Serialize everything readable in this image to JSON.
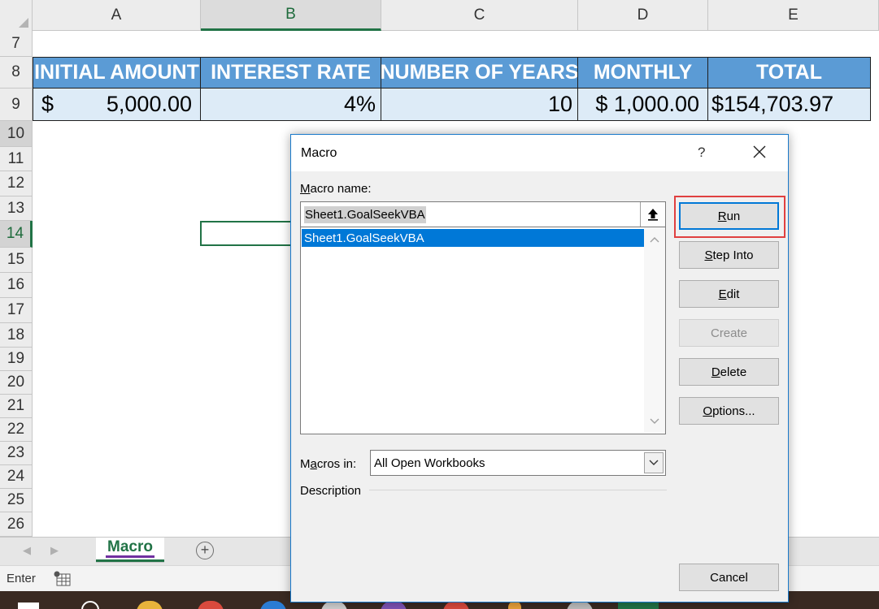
{
  "spreadsheet": {
    "columns": [
      "A",
      "B",
      "C",
      "D",
      "E"
    ],
    "rows": [
      "7",
      "8",
      "9",
      "10",
      "11",
      "12",
      "13",
      "14",
      "15",
      "16",
      "17",
      "18",
      "19",
      "20",
      "21",
      "22",
      "23",
      "24",
      "25",
      "26"
    ],
    "table_headers": [
      "INITIAL AMOUNT",
      "INTEREST RATE",
      "NUMBER OF YEARS",
      "MONTHLY",
      "TOTAL"
    ],
    "values": {
      "initial_currency": "$",
      "initial_amount": "5,000.00",
      "interest_rate": "4%",
      "years": "10",
      "monthly": "$ 1,000.00",
      "total": "$154,703.97"
    }
  },
  "sheet_tabs": {
    "active": "Macro"
  },
  "status_bar": {
    "mode": "Enter"
  },
  "dialog": {
    "title": "Macro",
    "help": "?",
    "macro_name_label_key": "M",
    "macro_name_label_rest": "acro name:",
    "macro_name_value": "Sheet1.GoalSeekVBA",
    "macro_list": [
      "Sheet1.GoalSeekVBA"
    ],
    "macros_in_label_pre": "M",
    "macros_in_label_key": "a",
    "macros_in_label_rest": "cros in:",
    "macros_in_value": "All Open Workbooks",
    "description_label": "Description",
    "buttons": {
      "run_key": "R",
      "run_rest": "un",
      "step_key": "S",
      "step_rest": "tep Into",
      "edit_key": "E",
      "edit_rest": "dit",
      "create": "Create",
      "delete_key": "D",
      "delete_rest": "elete",
      "options_key": "O",
      "options_rest": "ptions...",
      "cancel": "Cancel"
    }
  },
  "colors": {
    "header_fill": "#5b9bd5",
    "value_fill": "#ddebf7",
    "excel_green": "#217346",
    "selection_blue": "#0078d7",
    "highlight_red": "#e04040"
  }
}
